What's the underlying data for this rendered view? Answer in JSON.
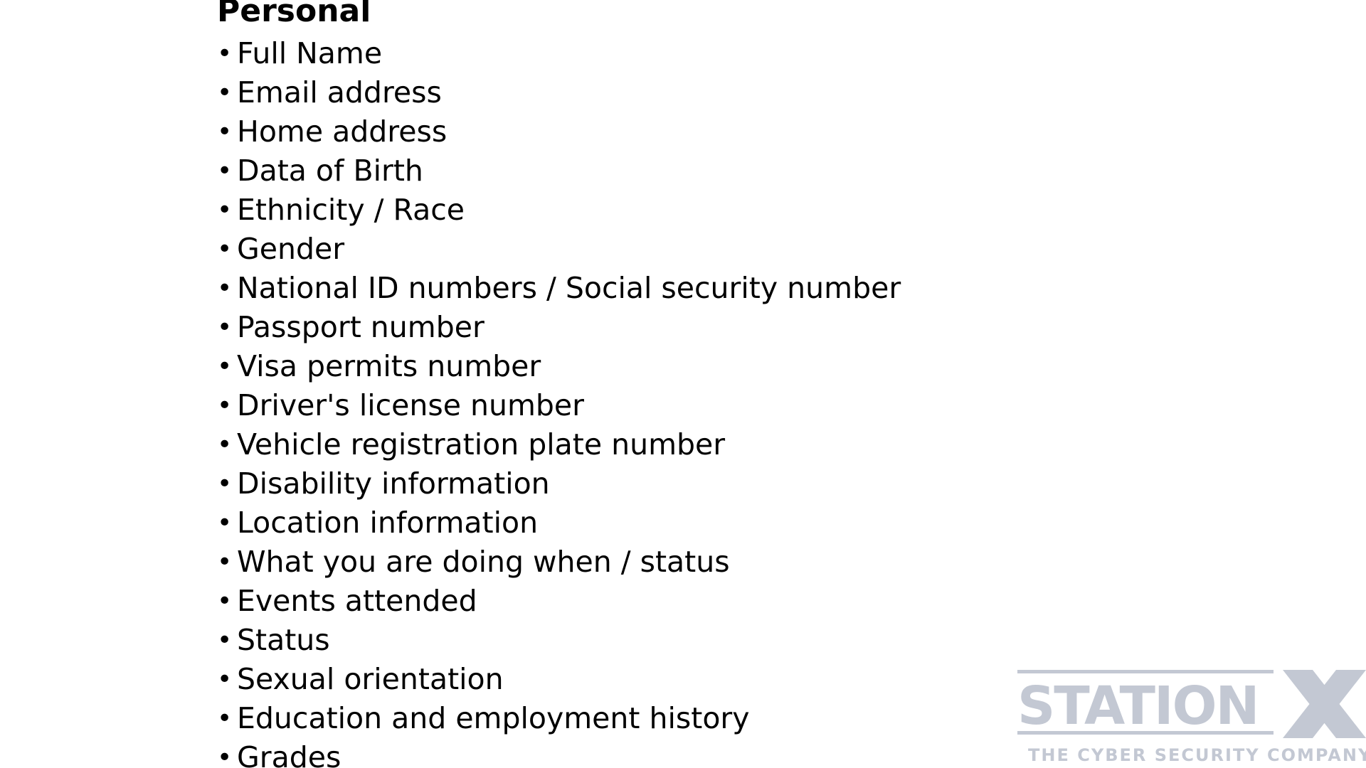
{
  "section": {
    "title": "Personal"
  },
  "items": [
    {
      "label": "Full Name"
    },
    {
      "label": "Email address"
    },
    {
      "label": "Home address"
    },
    {
      "label": "Data of Birth"
    },
    {
      "label": "Ethnicity / Race"
    },
    {
      "label": "Gender"
    },
    {
      "label": "National ID numbers / Social security number"
    },
    {
      "label": "Passport number"
    },
    {
      "label": "Visa permits number"
    },
    {
      "label": "Driver's license number"
    },
    {
      "label": "Vehicle registration plate number"
    },
    {
      "label": "Disability information"
    },
    {
      "label": "Location information"
    },
    {
      "label": "What you are doing when / status"
    },
    {
      "label": "Events attended"
    },
    {
      "label": "Status"
    },
    {
      "label": "Sexual orientation"
    },
    {
      "label": "Education and employment history"
    },
    {
      "label": "Grades"
    }
  ],
  "bullet_glyph": "•",
  "logo": {
    "wordmark": "STATIONX",
    "tagline": "THE CYBER SECURITY COMPANY",
    "color": "#c3c8d3"
  }
}
